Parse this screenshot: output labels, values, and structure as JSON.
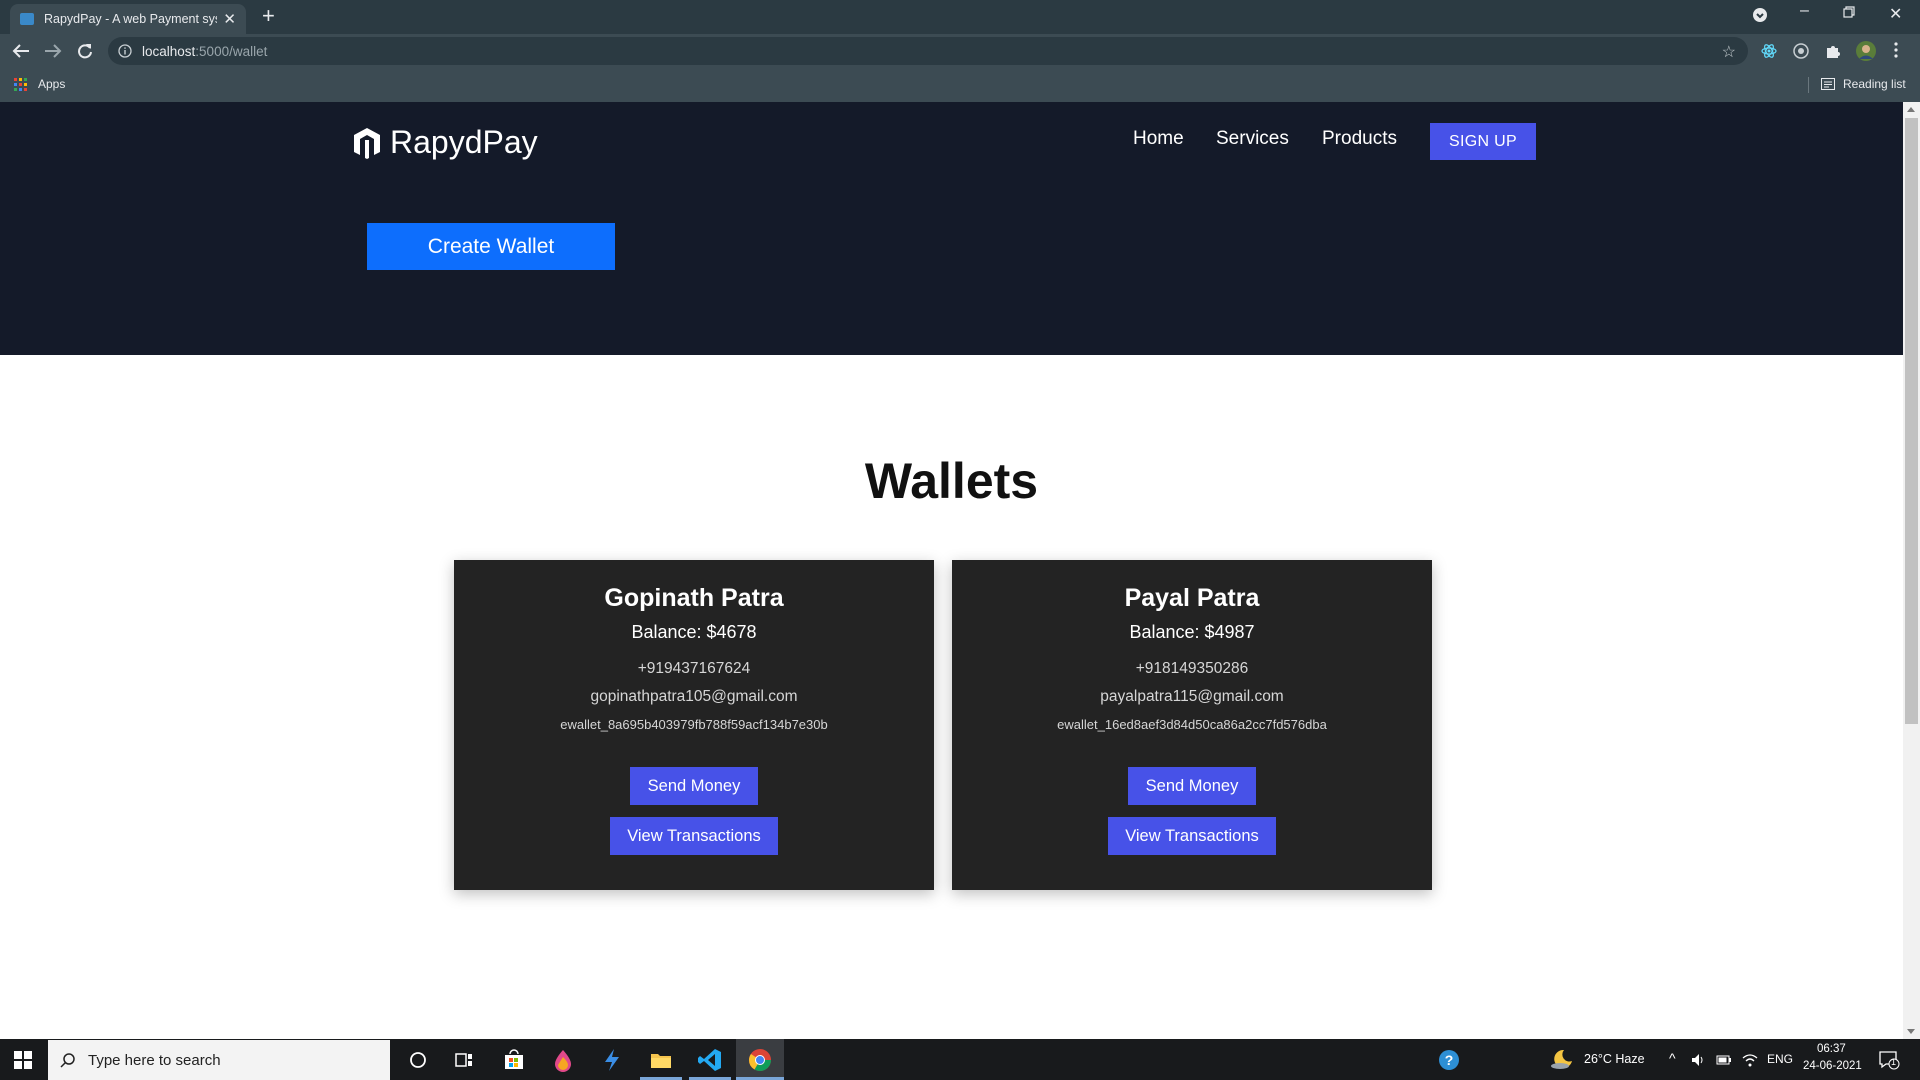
{
  "browser": {
    "tab_title": "RapydPay - A web Payment syste",
    "url_host": "localhost",
    "url_path": ":5000/wallet",
    "bookmarks_apps": "Apps",
    "reading_list": "Reading list"
  },
  "site": {
    "brand": "RapydPay",
    "nav": [
      "Home",
      "Services",
      "Products"
    ],
    "signup_label": "SIGN UP",
    "create_wallet_label": "Create Wallet",
    "heading": "Wallets",
    "accent_color": "#4752e8",
    "primary_button_color": "#0d6efd",
    "hero_color": "#141a29",
    "card_color": "#232323"
  },
  "wallets": [
    {
      "name": "Gopinath Patra",
      "balance": "Balance: $4678",
      "phone": "+919437167624",
      "email": "gopinathpatra105@gmail.com",
      "wallet_id": "ewallet_8a695b403979fb788f59acf134b7e30b",
      "send_label": "Send Money",
      "view_label": "View Transactions"
    },
    {
      "name": "Payal Patra",
      "balance": "Balance: $4987",
      "phone": "+918149350286",
      "email": "payalpatra115@gmail.com",
      "wallet_id": "ewallet_16ed8aef3d84d50ca86a2cc7fd576dba",
      "send_label": "Send Money",
      "view_label": "View Transactions"
    }
  ],
  "taskbar": {
    "search_placeholder": "Type here to search",
    "weather": "26°C  Haze",
    "language": "ENG",
    "time": "06:37",
    "date": "24-06-2021",
    "notification_count": "1"
  }
}
